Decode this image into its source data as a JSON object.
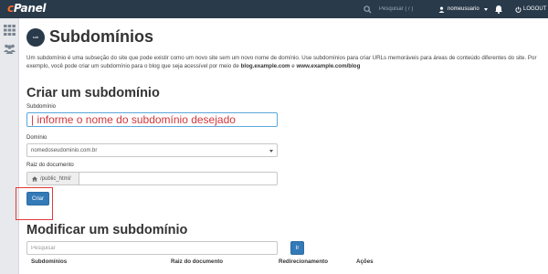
{
  "header": {
    "logo_c": "c",
    "logo_rest": "Panel",
    "search_placeholder": "Pesquisar ( / )",
    "username": "nomeusuario",
    "logout_label": "LOGOUT"
  },
  "page": {
    "icon_text": "sub",
    "title": "Subdomínios",
    "intro_part1": "Um subdomínio é uma subseção do site que pode existir como um novo site sem um novo nome de domínio. Use subdomínios para criar URLs memoráveis para áreas de conteúdo diferentes do site. Por exemplo, você pode criar um subdomínio para o blog que seja acessível por meio de ",
    "intro_bold1": "blog.example.com",
    "intro_mid": " e ",
    "intro_bold2": "www.example.com/blog"
  },
  "create": {
    "heading": "Criar um subdomínio",
    "subdomain_label": "Subdomínio",
    "subdomain_placeholder": "| informe o nome do subdomínio desejado",
    "domain_label": "Domínio",
    "domain_selected": "nomedoseudominio.com.br",
    "docroot_label": "Raiz do documento",
    "docroot_prefix": "/public_html/",
    "submit_label": "Criar"
  },
  "modify": {
    "heading": "Modificar um subdomínio",
    "search_placeholder": "Pesquisar",
    "go_label": "Ir",
    "columns": [
      "Subdomínios",
      "Raiz do documento",
      "Redirecionamento",
      "Ações"
    ]
  },
  "colors": {
    "header_bg": "#293a4a",
    "logo_accent": "#ff6c2c",
    "primary_button": "#337ab7",
    "annotation_red": "#e23b3b"
  },
  "icons": [
    "search-icon",
    "user-icon",
    "bell-icon",
    "logout-icon",
    "apps-grid-icon",
    "users-icon",
    "home-icon",
    "chevron-down-icon"
  ]
}
